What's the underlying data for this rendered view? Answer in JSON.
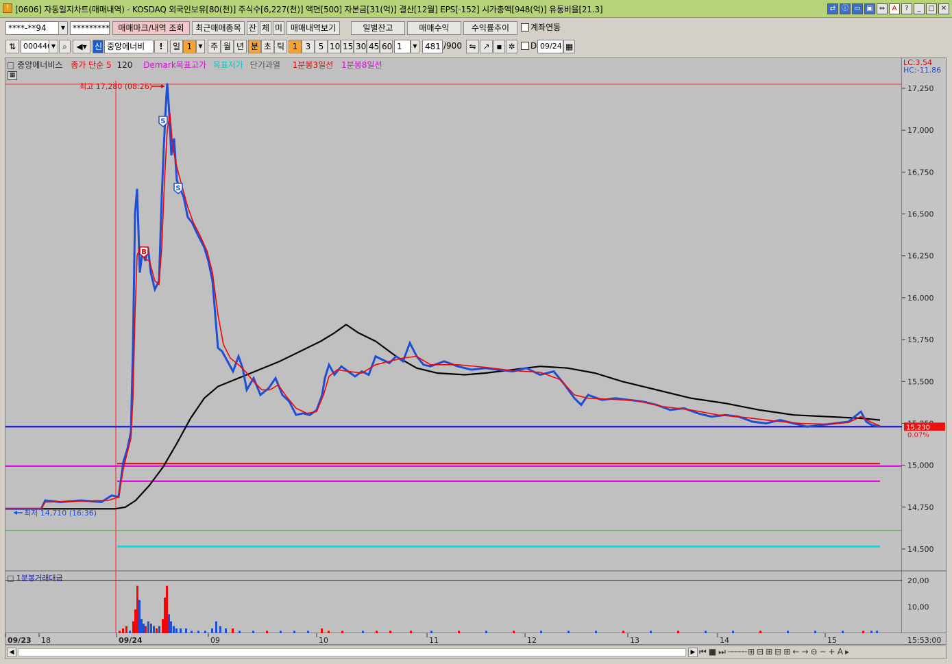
{
  "window": {
    "code": "[0606]",
    "title": "자동일지차트(매매내역) - KOSDAQ 외국인보유[80(천)] 주식수[6,227(천)] 액면[500] 자본금[31(억)] 결산[12월] EPS[-152] 시가총액[948(억)] 유통비율[21.3]",
    "button_icons": [
      "restore-icon",
      "help-icon",
      "monitor-icon",
      "window-icon",
      "link-icon",
      "font-icon",
      "question-icon",
      "minimize-icon",
      "maximize-icon",
      "close-icon"
    ],
    "button_glyphs": [
      "⇄",
      "ⓘ",
      "▭",
      "▣",
      "⇔",
      "A",
      "?",
      "_",
      "□",
      "✕"
    ]
  },
  "toolbar1": {
    "account_value": "****-**94",
    "password_value": "*********",
    "query_button": "매매마크/내역 조회",
    "recent_button": "최근매매종목",
    "tabs": [
      "잔",
      "체",
      "미"
    ],
    "view_button": "매매내역보기",
    "daily_balance": "일별잔고",
    "trade_profit": "매매수익",
    "return_trend": "수익률추이",
    "account_link": "계좌연동"
  },
  "toolbar2": {
    "code": "000440",
    "new_badge": "신",
    "stock_name": "중앙에너비",
    "mark": "!",
    "period_day": "일",
    "period_value": "1",
    "periods": [
      "주",
      "월",
      "년",
      "분",
      "초",
      "틱"
    ],
    "intervals": [
      "1",
      "3",
      "5",
      "10",
      "15",
      "30",
      "45",
      "60"
    ],
    "interval_value": "1",
    "count": "481",
    "count_total": "/900",
    "d_label": "D",
    "date_value": "09/24"
  },
  "legend": {
    "stock": "중앙에너비스",
    "ma": "종가 단순 5",
    "ma2": "120",
    "demark_high": "Demark목표고가",
    "demark_low": "목표저가",
    "short_overheat": "단기과열",
    "line3": "1분봉3일선",
    "line8": "1분봉8일선",
    "lc": "LC:3.54",
    "hc": "HC:-11.86"
  },
  "colors": {
    "up": "#ff0000",
    "down": "#1c4fd6",
    "ma120": "#000000",
    "magenta": "#e000e0",
    "cyan": "#00e0e0",
    "green": "#22aa22",
    "blue_line": "#0000dd"
  },
  "chart_data": {
    "type": "candlestick-line",
    "y_ticks": [
      17250,
      17000,
      16750,
      16500,
      16250,
      16000,
      15750,
      15500,
      15250,
      15000,
      14750,
      14500
    ],
    "y_tick_labels": [
      "17,250",
      "17,000",
      "16,750",
      "16,500",
      "16,250",
      "16,000",
      "15,750",
      "15,500",
      "15,250",
      "15,000",
      "14,750",
      "14,500"
    ],
    "ylim": [
      14380,
      17300
    ],
    "x_labels": [
      "09/23",
      "18",
      "09/24",
      "09",
      "10",
      "11",
      "12",
      "13",
      "14",
      "15"
    ],
    "high_label": "최고 17,280 (08:26)",
    "high_value": 17280,
    "low_label": "최저 14,710 (16:36)",
    "low_value": 14710,
    "current_price": "15,230",
    "current_value": 15230,
    "change_pct": "0.07%",
    "blue_level": 15230,
    "red_level": 15010,
    "magenta_level_1": 14995,
    "magenta_level_2": 14905,
    "green_level": 14610,
    "cyan_level": 14515,
    "price_path": [
      [
        0,
        14740
      ],
      [
        52,
        14740
      ],
      [
        58,
        14790
      ],
      [
        80,
        14780
      ],
      [
        110,
        14790
      ],
      [
        140,
        14780
      ],
      [
        155,
        14820
      ],
      [
        165,
        14810
      ],
      [
        172,
        15020
      ],
      [
        178,
        15100
      ],
      [
        183,
        15200
      ],
      [
        186,
        15700
      ],
      [
        189,
        16500
      ],
      [
        192,
        16650
      ],
      [
        196,
        16150
      ],
      [
        200,
        16280
      ],
      [
        204,
        16220
      ],
      [
        208,
        16300
      ],
      [
        212,
        16150
      ],
      [
        218,
        16050
      ],
      [
        224,
        16100
      ],
      [
        228,
        16600
      ],
      [
        231,
        16900
      ],
      [
        234,
        17150
      ],
      [
        236,
        17280
      ],
      [
        239,
        17100
      ],
      [
        242,
        16850
      ],
      [
        246,
        16950
      ],
      [
        250,
        16700
      ],
      [
        255,
        16650
      ],
      [
        260,
        16600
      ],
      [
        266,
        16480
      ],
      [
        272,
        16450
      ],
      [
        280,
        16380
      ],
      [
        290,
        16300
      ],
      [
        296,
        16220
      ],
      [
        302,
        16100
      ],
      [
        306,
        15900
      ],
      [
        310,
        15700
      ],
      [
        316,
        15680
      ],
      [
        324,
        15620
      ],
      [
        332,
        15560
      ],
      [
        340,
        15650
      ],
      [
        346,
        15580
      ],
      [
        352,
        15450
      ],
      [
        362,
        15520
      ],
      [
        372,
        15420
      ],
      [
        384,
        15460
      ],
      [
        394,
        15520
      ],
      [
        404,
        15420
      ],
      [
        414,
        15380
      ],
      [
        424,
        15300
      ],
      [
        434,
        15310
      ],
      [
        444,
        15300
      ],
      [
        454,
        15330
      ],
      [
        462,
        15420
      ],
      [
        466,
        15520
      ],
      [
        472,
        15600
      ],
      [
        480,
        15540
      ],
      [
        490,
        15590
      ],
      [
        500,
        15560
      ],
      [
        510,
        15530
      ],
      [
        520,
        15560
      ],
      [
        530,
        15540
      ],
      [
        540,
        15650
      ],
      [
        550,
        15630
      ],
      [
        560,
        15610
      ],
      [
        570,
        15650
      ],
      [
        580,
        15620
      ],
      [
        590,
        15730
      ],
      [
        600,
        15650
      ],
      [
        610,
        15600
      ],
      [
        620,
        15590
      ],
      [
        640,
        15620
      ],
      [
        660,
        15590
      ],
      [
        680,
        15570
      ],
      [
        700,
        15580
      ],
      [
        720,
        15570
      ],
      [
        740,
        15560
      ],
      [
        760,
        15580
      ],
      [
        780,
        15540
      ],
      [
        800,
        15560
      ],
      [
        816,
        15480
      ],
      [
        830,
        15400
      ],
      [
        840,
        15360
      ],
      [
        850,
        15420
      ],
      [
        870,
        15390
      ],
      [
        890,
        15400
      ],
      [
        910,
        15390
      ],
      [
        930,
        15380
      ],
      [
        950,
        15360
      ],
      [
        970,
        15330
      ],
      [
        990,
        15340
      ],
      [
        1010,
        15310
      ],
      [
        1030,
        15290
      ],
      [
        1050,
        15300
      ],
      [
        1070,
        15290
      ],
      [
        1090,
        15260
      ],
      [
        1110,
        15250
      ],
      [
        1130,
        15270
      ],
      [
        1150,
        15250
      ],
      [
        1170,
        15230
      ],
      [
        1190,
        15240
      ],
      [
        1210,
        15250
      ],
      [
        1230,
        15260
      ],
      [
        1248,
        15320
      ],
      [
        1256,
        15260
      ],
      [
        1264,
        15240
      ],
      [
        1276,
        15230
      ]
    ],
    "ma5_path": [
      [
        0,
        14740
      ],
      [
        52,
        14740
      ],
      [
        58,
        14780
      ],
      [
        100,
        14785
      ],
      [
        150,
        14790
      ],
      [
        165,
        14810
      ],
      [
        172,
        14980
      ],
      [
        178,
        15080
      ],
      [
        183,
        15160
      ],
      [
        186,
        15400
      ],
      [
        189,
        15900
      ],
      [
        192,
        16250
      ],
      [
        196,
        16300
      ],
      [
        200,
        16250
      ],
      [
        204,
        16230
      ],
      [
        210,
        16220
      ],
      [
        218,
        16100
      ],
      [
        224,
        16080
      ],
      [
        228,
        16300
      ],
      [
        232,
        16700
      ],
      [
        236,
        17000
      ],
      [
        240,
        17100
      ],
      [
        244,
        16900
      ],
      [
        250,
        16780
      ],
      [
        258,
        16660
      ],
      [
        266,
        16540
      ],
      [
        274,
        16450
      ],
      [
        284,
        16370
      ],
      [
        294,
        16280
      ],
      [
        302,
        16150
      ],
      [
        310,
        15900
      ],
      [
        318,
        15720
      ],
      [
        328,
        15640
      ],
      [
        340,
        15600
      ],
      [
        350,
        15560
      ],
      [
        362,
        15500
      ],
      [
        374,
        15450
      ],
      [
        386,
        15450
      ],
      [
        398,
        15480
      ],
      [
        410,
        15410
      ],
      [
        424,
        15340
      ],
      [
        440,
        15310
      ],
      [
        454,
        15320
      ],
      [
        464,
        15420
      ],
      [
        472,
        15530
      ],
      [
        484,
        15570
      ],
      [
        500,
        15560
      ],
      [
        520,
        15550
      ],
      [
        540,
        15600
      ],
      [
        560,
        15620
      ],
      [
        580,
        15640
      ],
      [
        600,
        15650
      ],
      [
        620,
        15600
      ],
      [
        660,
        15600
      ],
      [
        700,
        15585
      ],
      [
        740,
        15565
      ],
      [
        780,
        15555
      ],
      [
        810,
        15510
      ],
      [
        830,
        15420
      ],
      [
        850,
        15400
      ],
      [
        880,
        15395
      ],
      [
        920,
        15385
      ],
      [
        960,
        15350
      ],
      [
        1000,
        15330
      ],
      [
        1040,
        15300
      ],
      [
        1080,
        15285
      ],
      [
        1120,
        15265
      ],
      [
        1160,
        15250
      ],
      [
        1200,
        15245
      ],
      [
        1230,
        15255
      ],
      [
        1248,
        15290
      ],
      [
        1264,
        15255
      ],
      [
        1276,
        15235
      ]
    ],
    "ma120_path": [
      [
        0,
        14740
      ],
      [
        160,
        14740
      ],
      [
        175,
        14750
      ],
      [
        190,
        14790
      ],
      [
        210,
        14880
      ],
      [
        230,
        14990
      ],
      [
        250,
        15130
      ],
      [
        270,
        15280
      ],
      [
        290,
        15400
      ],
      [
        310,
        15470
      ],
      [
        340,
        15520
      ],
      [
        370,
        15570
      ],
      [
        400,
        15620
      ],
      [
        430,
        15680
      ],
      [
        460,
        15740
      ],
      [
        480,
        15790
      ],
      [
        497,
        15840
      ],
      [
        515,
        15790
      ],
      [
        540,
        15740
      ],
      [
        570,
        15650
      ],
      [
        600,
        15580
      ],
      [
        630,
        15550
      ],
      [
        670,
        15540
      ],
      [
        700,
        15550
      ],
      [
        740,
        15570
      ],
      [
        780,
        15590
      ],
      [
        820,
        15580
      ],
      [
        860,
        15550
      ],
      [
        900,
        15500
      ],
      [
        950,
        15450
      ],
      [
        1000,
        15400
      ],
      [
        1050,
        15370
      ],
      [
        1100,
        15330
      ],
      [
        1150,
        15300
      ],
      [
        1200,
        15290
      ],
      [
        1250,
        15280
      ],
      [
        1276,
        15270
      ]
    ],
    "signals": [
      {
        "label": "S",
        "x": 230,
        "y": 17050
      },
      {
        "label": "B",
        "x": 202,
        "y": 16270
      },
      {
        "label": "S",
        "x": 252,
        "y": 16650
      }
    ],
    "volume_title": "1분봉거래대금",
    "volume_ticks": [
      "20,00",
      "10,00"
    ],
    "volume_bars": [
      [
        165,
        1,
        1
      ],
      [
        170,
        2,
        1
      ],
      [
        175,
        3,
        1
      ],
      [
        180,
        1,
        2
      ],
      [
        185,
        5,
        1
      ],
      [
        188,
        10,
        1
      ],
      [
        191,
        20,
        1
      ],
      [
        194,
        14,
        2
      ],
      [
        197,
        6,
        2
      ],
      [
        200,
        4,
        2
      ],
      [
        203,
        3,
        1
      ],
      [
        207,
        5,
        2
      ],
      [
        211,
        4,
        2
      ],
      [
        215,
        3,
        2
      ],
      [
        219,
        2,
        1
      ],
      [
        223,
        3,
        2
      ],
      [
        228,
        6,
        1
      ],
      [
        231,
        15,
        1
      ],
      [
        234,
        20,
        1
      ],
      [
        237,
        8,
        2
      ],
      [
        240,
        5,
        2
      ],
      [
        244,
        3,
        2
      ],
      [
        248,
        2,
        2
      ],
      [
        254,
        2,
        2
      ],
      [
        262,
        2,
        2
      ],
      [
        270,
        1,
        2
      ],
      [
        280,
        1,
        2
      ],
      [
        290,
        1,
        2
      ],
      [
        300,
        2,
        2
      ],
      [
        306,
        5,
        2
      ],
      [
        312,
        3,
        2
      ],
      [
        320,
        2,
        2
      ],
      [
        330,
        2,
        1
      ],
      [
        340,
        1,
        2
      ],
      [
        360,
        1,
        2
      ],
      [
        380,
        1,
        1
      ],
      [
        400,
        1,
        2
      ],
      [
        420,
        1,
        2
      ],
      [
        440,
        1,
        2
      ],
      [
        460,
        2,
        1
      ],
      [
        470,
        1,
        1
      ],
      [
        490,
        1,
        1
      ],
      [
        520,
        1,
        2
      ],
      [
        540,
        1,
        1
      ],
      [
        560,
        1,
        1
      ],
      [
        590,
        1,
        1
      ],
      [
        620,
        1,
        2
      ],
      [
        660,
        1,
        1
      ],
      [
        700,
        1,
        2
      ],
      [
        740,
        1,
        1
      ],
      [
        780,
        1,
        2
      ],
      [
        820,
        1,
        2
      ],
      [
        860,
        1,
        2
      ],
      [
        900,
        1,
        1
      ],
      [
        940,
        1,
        2
      ],
      [
        980,
        1,
        1
      ],
      [
        1020,
        1,
        2
      ],
      [
        1060,
        1,
        2
      ],
      [
        1100,
        1,
        1
      ],
      [
        1140,
        1,
        2
      ],
      [
        1180,
        1,
        2
      ],
      [
        1220,
        1,
        2
      ],
      [
        1250,
        1,
        1
      ],
      [
        1262,
        1,
        2
      ],
      [
        1270,
        1,
        2
      ]
    ],
    "time_label": "15:53:00"
  }
}
